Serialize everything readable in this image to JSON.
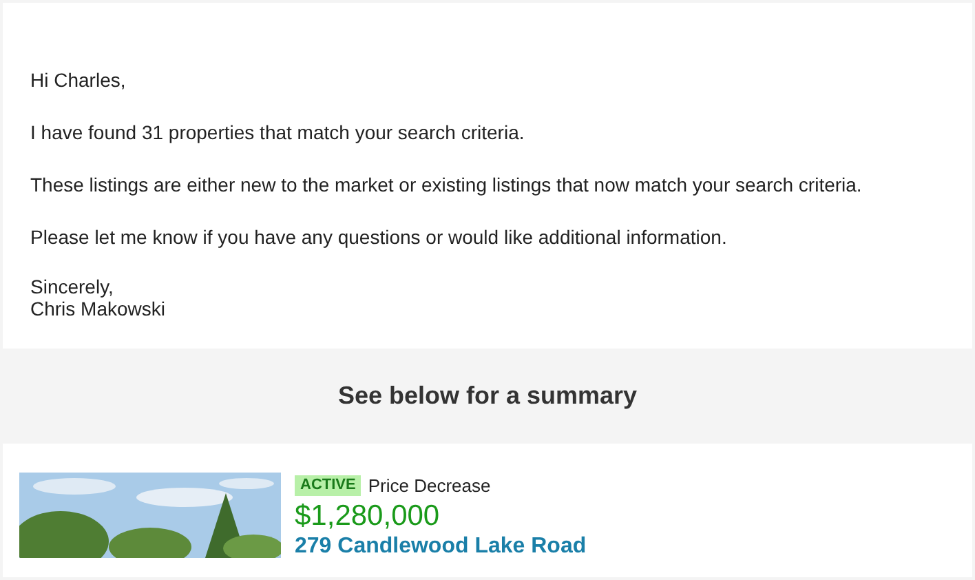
{
  "message": {
    "greeting": "Hi Charles,",
    "paragraphs": [
      "I have found 31 properties that match your search criteria.",
      "These listings are either new to the market or existing listings that now match your search criteria.",
      "Please let me know if you have any questions or would like additional information."
    ],
    "closing": "Sincerely,",
    "signature": "Chris Makowski"
  },
  "summary_heading": "See below for a summary",
  "listings": [
    {
      "kind": "picture",
      "status": "ACTIVE",
      "change": "Price Decrease",
      "price": "$1,280,000",
      "address": "279 Candlewood Lake Road"
    }
  ]
}
